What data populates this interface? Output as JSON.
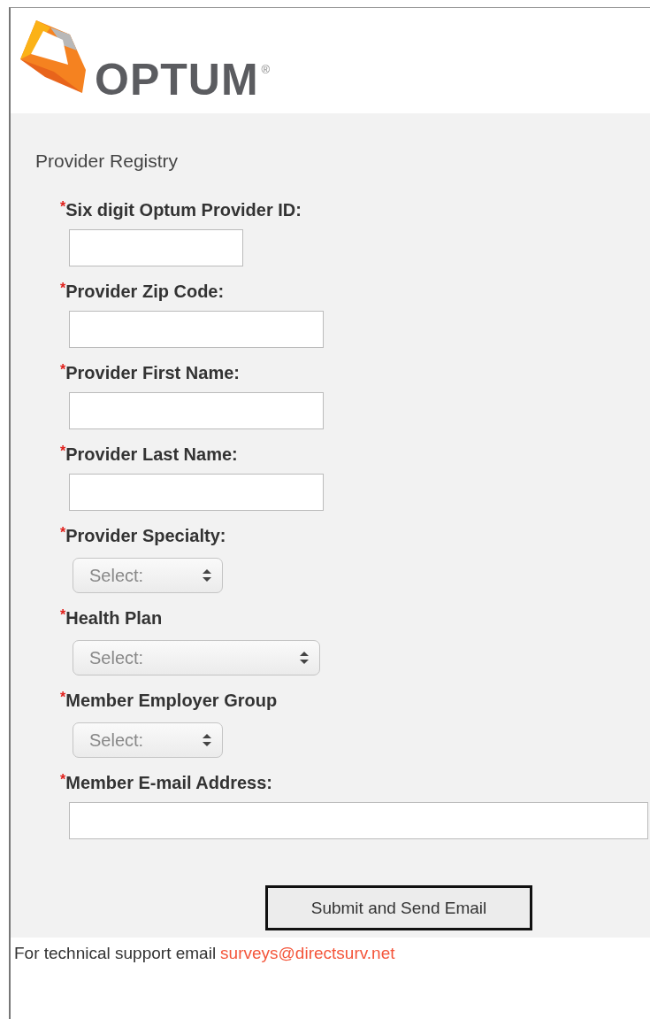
{
  "logo": {
    "wordmark": "OPTUM",
    "registered": "®"
  },
  "form": {
    "title": "Provider Registry",
    "fields": [
      {
        "kind": "text",
        "required_mark": "*",
        "label": "Six digit Optum Provider ID:"
      },
      {
        "kind": "text",
        "required_mark": "*",
        "label": "Provider Zip Code:"
      },
      {
        "kind": "text",
        "required_mark": "*",
        "label": "Provider First Name:"
      },
      {
        "kind": "text",
        "required_mark": "*",
        "label": "Provider Last Name:"
      },
      {
        "kind": "select",
        "required_mark": "*",
        "label": "Provider Specialty:",
        "value": "Select:"
      },
      {
        "kind": "select",
        "required_mark": "*",
        "label": "Health Plan",
        "value": "Select:"
      },
      {
        "kind": "select",
        "required_mark": "*",
        "label": "Member Employer Group",
        "value": "Select:"
      },
      {
        "kind": "text",
        "required_mark": "*",
        "label": "Member E-mail Address:"
      }
    ],
    "submit": "Submit and Send Email"
  },
  "footer": {
    "text": "For technical support email",
    "link": "surveys@directsurv.net"
  }
}
